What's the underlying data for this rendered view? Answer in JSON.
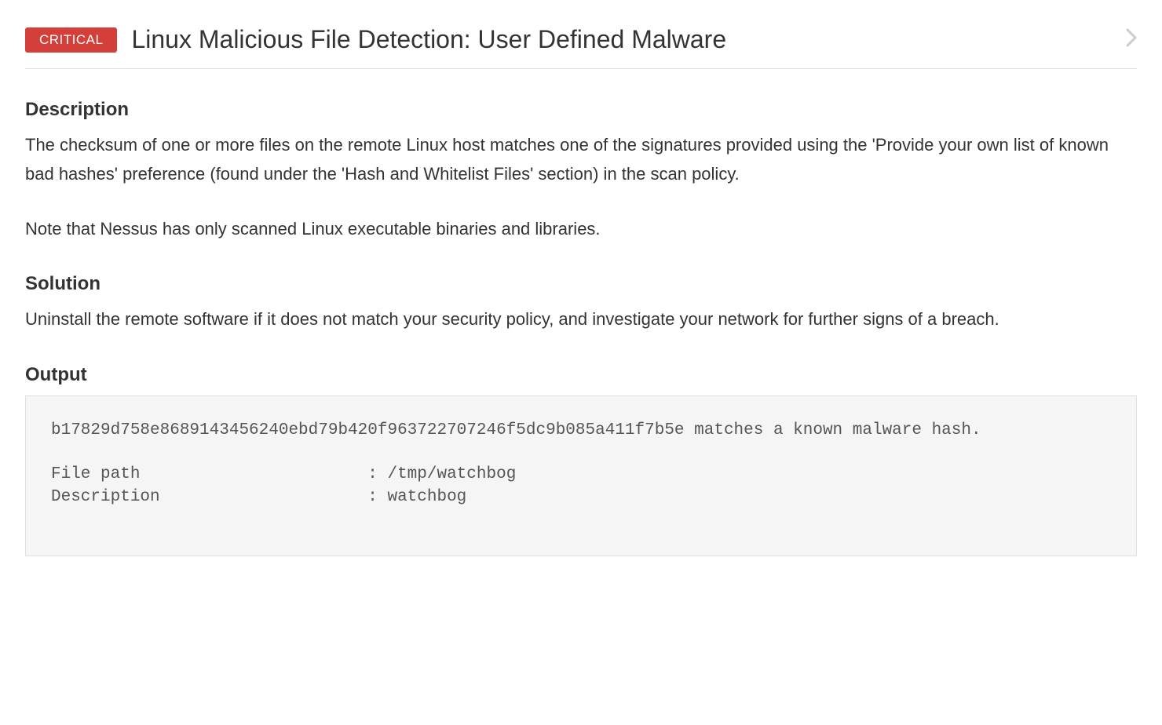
{
  "finding": {
    "severity": "CRITICAL",
    "title": "Linux Malicious File Detection: User Defined Malware"
  },
  "sections": {
    "description": {
      "heading": "Description",
      "para1": "The checksum of one or more files on the remote Linux host matches one of the signatures provided using the 'Provide your own list of known bad hashes' preference (found under the 'Hash and Whitelist Files' section) in the scan policy.",
      "para2": "Note that Nessus has only scanned Linux executable binaries and libraries."
    },
    "solution": {
      "heading": "Solution",
      "text": "Uninstall the remote software if it does not match your security policy, and investigate your network for further signs of a breach."
    },
    "output": {
      "heading": "Output",
      "text": "b17829d758e8689143456240ebd79b420f963722707246f5dc9b085a411f7b5e matches a known malware hash.\n\nFile path                       : /tmp/watchbog\nDescription                     : watchbog"
    }
  }
}
